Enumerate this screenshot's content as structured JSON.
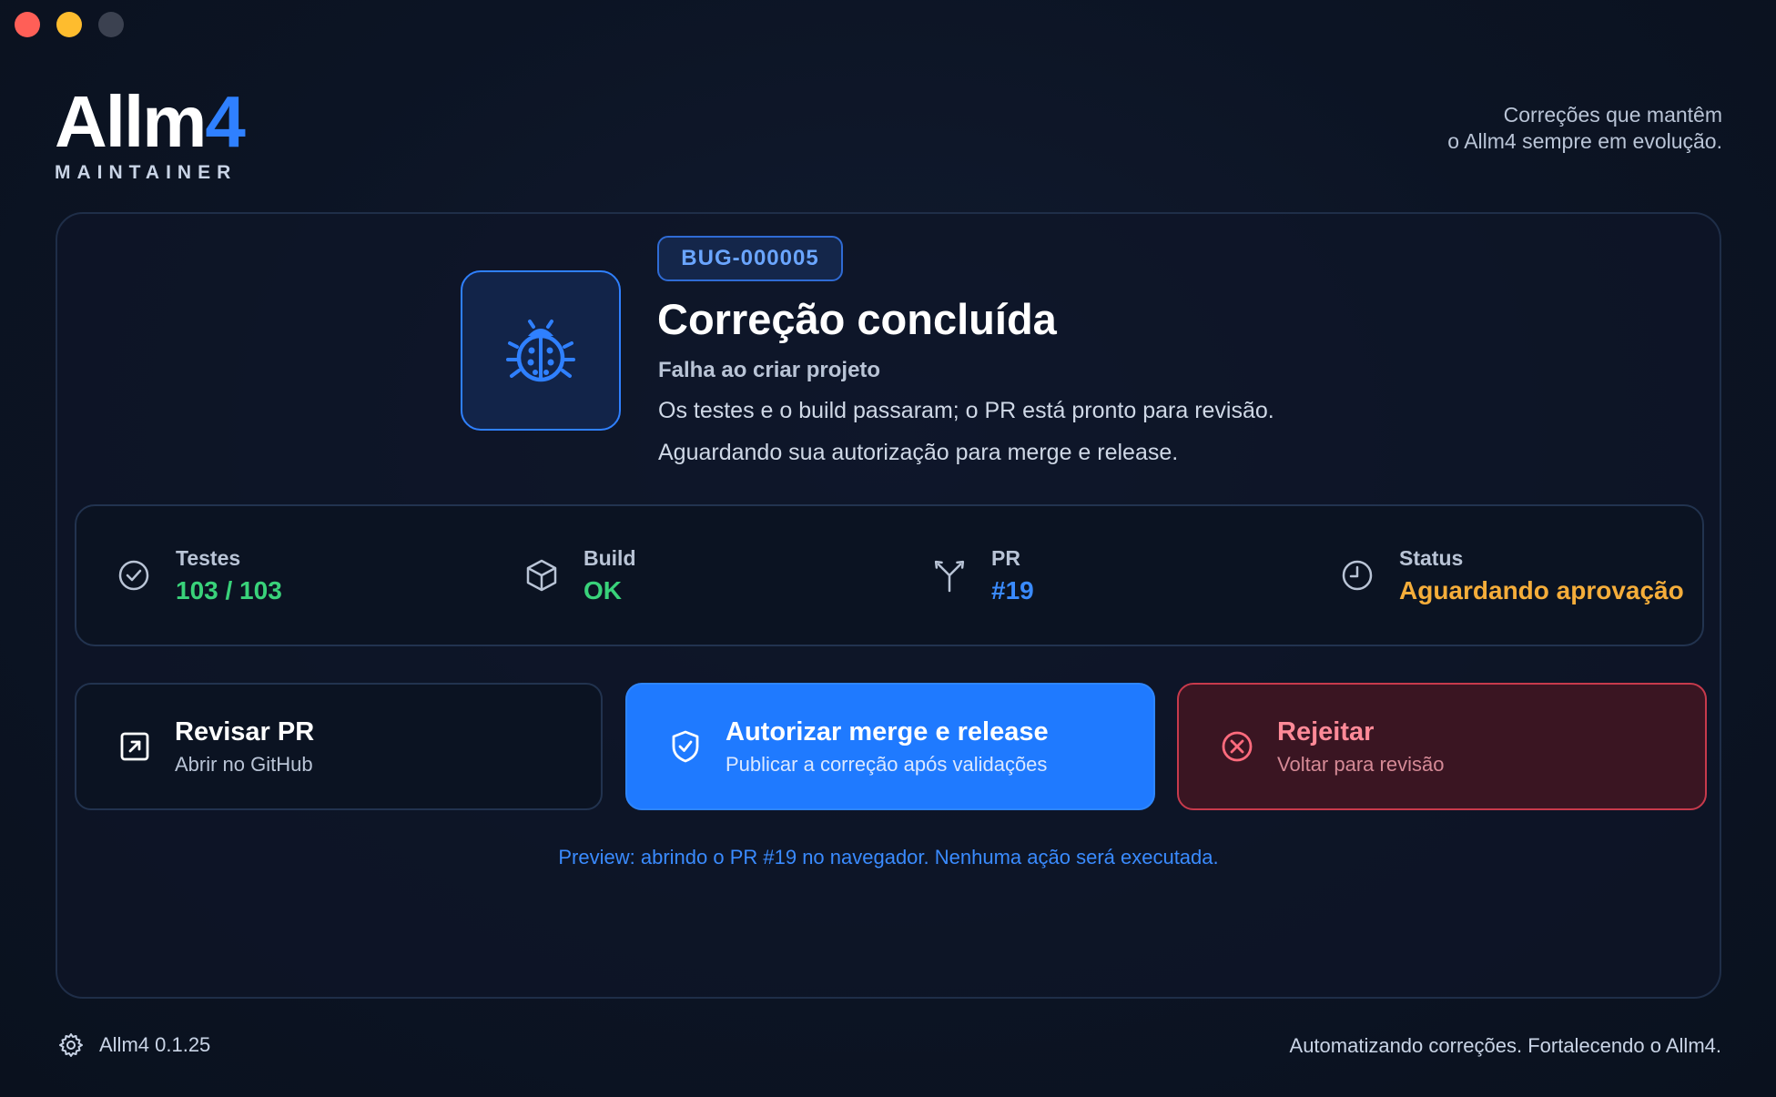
{
  "brand": {
    "logo_main": "Allm",
    "logo_accent": "4",
    "logo_sub": "MAINTAINER"
  },
  "tagline": {
    "line1": "Correções que mantêm",
    "line2": "o Allm4 sempre em evolução."
  },
  "issue": {
    "id": "BUG-000005",
    "title": "Correção concluída",
    "subtitle": "Falha ao criar projeto",
    "line1": "Os testes e o build passaram; o PR está pronto para revisão.",
    "line2": "Aguardando sua autorização para merge e release."
  },
  "stats": [
    {
      "label": "Testes",
      "value": "103 / 103",
      "icon": "check-circle-icon",
      "color": "#39d27a"
    },
    {
      "label": "Build",
      "value": "OK",
      "icon": "box-icon",
      "color": "#39d27a"
    },
    {
      "label": "PR",
      "value": "#19",
      "icon": "merge-icon",
      "color": "#3a8bff"
    },
    {
      "label": "Status",
      "value": "Aguardando aprovação",
      "icon": "clock-icon",
      "color": "#f5ad3a"
    }
  ],
  "actions": {
    "review": {
      "title": "Revisar PR",
      "subtitle": "Abrir no GitHub",
      "icon": "external-link-icon"
    },
    "approve": {
      "title": "Autorizar merge e release",
      "subtitle": "Publicar a correção após validações",
      "icon": "shield-check-icon"
    },
    "reject": {
      "title": "Rejeitar",
      "subtitle": "Voltar para revisão",
      "icon": "x-circle-icon"
    }
  },
  "preview_text": "Preview: abrindo o PR #19 no navegador. Nenhuma ação será executada.",
  "footer": {
    "version": "Allm4 0.1.25",
    "slogan": "Automatizando correções. Fortalecendo o Allm4."
  },
  "colors": {
    "accent": "#2f80ff",
    "success": "#39d27a",
    "warning": "#f5ad3a",
    "danger": "#c73a4c",
    "background": "#0b1220"
  }
}
